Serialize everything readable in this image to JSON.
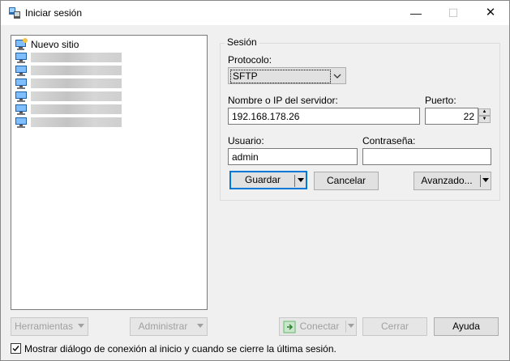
{
  "window": {
    "title": "Iniciar sesión"
  },
  "controls": {
    "minimize": "—",
    "maximize": "☐",
    "close": "✕"
  },
  "tree": {
    "items": [
      {
        "label": "Nuevo sitio",
        "redacted": false
      },
      {
        "label": "",
        "redacted": true
      },
      {
        "label": "",
        "redacted": true
      },
      {
        "label": "",
        "redacted": true
      },
      {
        "label": "",
        "redacted": true
      },
      {
        "label": "",
        "redacted": true
      },
      {
        "label": "",
        "redacted": true
      }
    ]
  },
  "session": {
    "group_label": "Sesión",
    "protocol_label": "Protocolo:",
    "protocol_value": "SFTP",
    "host_label": "Nombre o IP del servidor:",
    "host_value": "192.168.178.26",
    "port_label": "Puerto:",
    "port_value": "22",
    "user_label": "Usuario:",
    "user_value": "admin",
    "password_label": "Contraseña:",
    "password_value": "",
    "save_label": "Guardar",
    "cancel_label": "Cancelar",
    "advanced_label": "Avanzado..."
  },
  "footer": {
    "tools_label": "Herramientas",
    "manage_label": "Administrar",
    "connect_label": "Conectar",
    "close_label": "Cerrar",
    "help_label": "Ayuda",
    "show_dialog_label": "Mostrar diálogo de conexión al inicio y cuando se cierre la última sesión.",
    "show_dialog_checked": true
  },
  "colors": {
    "accent": "#0078d7",
    "window_bg": "#f0f0f0",
    "button_bg": "#e1e1e1"
  }
}
